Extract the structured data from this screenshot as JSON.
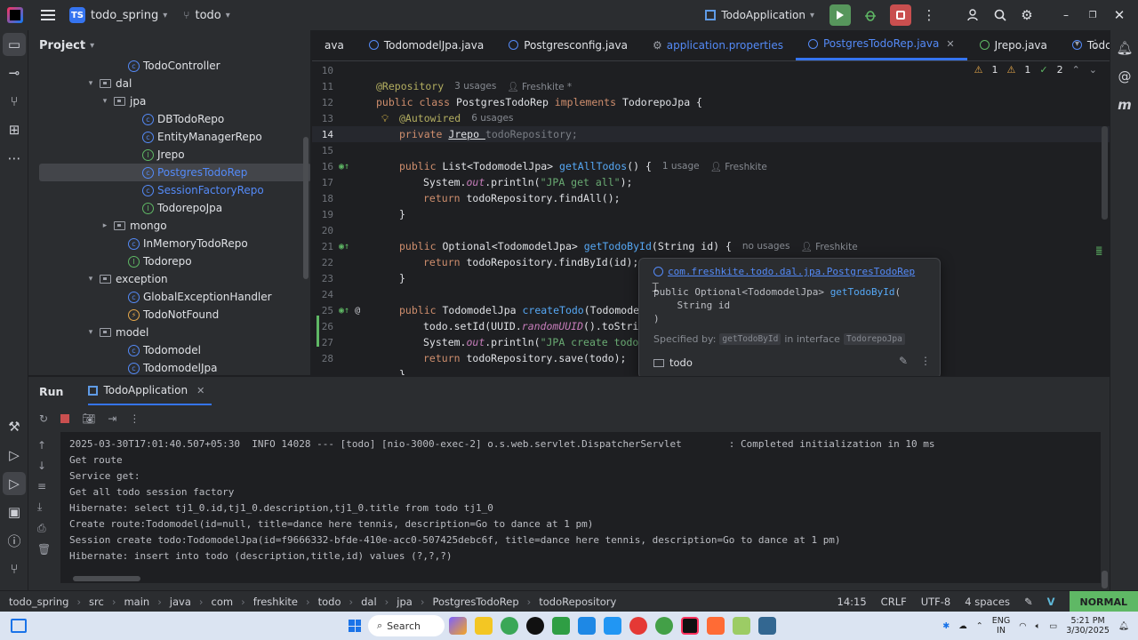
{
  "titlebar": {
    "project_badge": "TS",
    "project_name": "todo_spring",
    "branch": "todo",
    "run_config": "TodoApplication"
  },
  "project_panel": {
    "title": "Project",
    "tree": [
      {
        "label": "TodoController",
        "kind": "class",
        "indent": 7
      },
      {
        "label": "dal",
        "kind": "package",
        "indent": 5,
        "expanded": true
      },
      {
        "label": "jpa",
        "kind": "package",
        "indent": 6,
        "expanded": true
      },
      {
        "label": "DBTodoRepo",
        "kind": "class",
        "indent": 8
      },
      {
        "label": "EntityManagerRepo",
        "kind": "class",
        "indent": 8
      },
      {
        "label": "Jrepo",
        "kind": "interface",
        "indent": 8
      },
      {
        "label": "PostgresTodoRep",
        "kind": "class",
        "indent": 8,
        "selected": true
      },
      {
        "label": "SessionFactoryRepo",
        "kind": "class",
        "indent": 8,
        "blue": true
      },
      {
        "label": "TodorepoJpa",
        "kind": "interface",
        "indent": 8
      },
      {
        "label": "mongo",
        "kind": "package",
        "indent": 6,
        "expanded": false
      },
      {
        "label": "InMemoryTodoRepo",
        "kind": "class",
        "indent": 7
      },
      {
        "label": "Todorepo",
        "kind": "interface",
        "indent": 7
      },
      {
        "label": "exception",
        "kind": "package",
        "indent": 5,
        "expanded": true
      },
      {
        "label": "GlobalExceptionHandler",
        "kind": "class",
        "indent": 7
      },
      {
        "label": "TodoNotFound",
        "kind": "exception",
        "indent": 7
      },
      {
        "label": "model",
        "kind": "package",
        "indent": 5,
        "expanded": true
      },
      {
        "label": "Todomodel",
        "kind": "class",
        "indent": 7
      },
      {
        "label": "TodomodelJpa",
        "kind": "class",
        "indent": 7
      }
    ]
  },
  "editor": {
    "tabs": [
      {
        "label": "ava",
        "icon": "none"
      },
      {
        "label": "TodomodelJpa.java",
        "icon": "class"
      },
      {
        "label": "Postgresconfig.java",
        "icon": "class"
      },
      {
        "label": "application.properties",
        "icon": "gear",
        "blue": true
      },
      {
        "label": "PostgresTodoRep.java",
        "icon": "class",
        "active": true,
        "blue": true
      },
      {
        "label": "Jrepo.java",
        "icon": "interface"
      },
      {
        "label": "Todc",
        "icon": "class"
      }
    ],
    "inspections": {
      "warnings": "1",
      "weak": "1",
      "checks": "2"
    },
    "code": {
      "l10": "10",
      "l11": "11",
      "l11_ann": "@Repository",
      "l11_hint1": "3 usages",
      "l11_hint2": "Freshkite *",
      "l12": "12",
      "l12_kw": "public class ",
      "l12_name": "PostgresTodoRep ",
      "l12_kw2": "implements ",
      "l12_type": "TodorepoJpa {",
      "l13": "13",
      "l13_ann": "@Autowired",
      "l13_hint": "6 usages",
      "l14": "14",
      "l14_kw": "private ",
      "l14_type": "Jrepo ",
      "l14_field": "todoRepository;",
      "l15": "15",
      "l16": "16",
      "l16_kw": "public ",
      "l16_type": "List<TodomodelJpa> ",
      "l16_fn": "getAllTodos",
      "l16_rest": "() {",
      "l16_hint1": "1 usage",
      "l16_hint2": "Freshkite",
      "l17": "17",
      "l17_a": "System.",
      "l17_out": "out",
      "l17_b": ".println(",
      "l17_str": "\"JPA get all\"",
      "l17_c": ");",
      "l18": "18",
      "l18_kw": "return ",
      "l18_rest": "todoRepository.findAll();",
      "l19": "19",
      "l19_text": "}",
      "l20": "20",
      "l21": "21",
      "l21_kw": "public ",
      "l21_type": "Optional<TodomodelJpa> ",
      "l21_fn": "getTodoById",
      "l21_rest": "(String id) {",
      "l21_hint1": "no usages",
      "l21_hint2": "Freshkite",
      "l22": "22",
      "l22_kw": "return ",
      "l22_rest": "todoRepository.findById(id);",
      "l23": "23",
      "l23_text": "}",
      "l24": "24",
      "l25": "25",
      "l25_kw": "public ",
      "l25_type": "TodomodelJpa ",
      "l25_fn": "createTodo",
      "l25_rest": "(Todomodel",
      "l26": "26",
      "l26_a": "todo.setId(UUID.",
      "l26_it": "randomUUID",
      "l26_b": "().toStrin",
      "l27": "27",
      "l27_a": "System.",
      "l27_out": "out",
      "l27_b": ".println(",
      "l27_str": "\"JPA create todo:",
      "l28": "28",
      "l28_kw": "return ",
      "l28_rest": "todoRepository.save(todo);",
      "l29": "",
      "l29_text": "}"
    }
  },
  "popup": {
    "link": "com.freshkite.todo.dal.jpa.PostgresTodoRep",
    "sig_line1": "public Optional<TodomodelJpa> ",
    "sig_fn": "getTodoById",
    "sig_paren": "(",
    "sig_line2": "    String id",
    "sig_line3": ")",
    "spec_prefix": "Specified by:",
    "spec_method": "getTodoById",
    "spec_mid": "in interface",
    "spec_iface": "TodorepoJpa",
    "module": "todo"
  },
  "run_panel": {
    "title": "Run",
    "tab": "TodoApplication",
    "console": [
      "2025-03-30T17:01:40.507+05:30  INFO 14028 --- [todo] [nio-3000-exec-2] o.s.web.servlet.DispatcherServlet        : Completed initialization in 10 ms",
      "Get route",
      "Service get:",
      "Get all todo session factory",
      "Hibernate: select tj1_0.id,tj1_0.description,tj1_0.title from todo tj1_0",
      "Create route:Todomodel(id=null, title=dance here tennis, description=Go to dance at 1 pm)",
      "Session create todo:TodomodelJpa(id=f9666332-bfde-410e-acc0-507425debc6f, title=dance here tennis, description=Go to dance at 1 pm)",
      "Hibernate: insert into todo (description,title,id) values (?,?,?)"
    ]
  },
  "statusbar": {
    "breadcrumbs": [
      "todo_spring",
      "src",
      "main",
      "java",
      "com",
      "freshkite",
      "todo",
      "dal",
      "jpa",
      "PostgresTodoRep",
      "todoRepository"
    ],
    "position": "14:15",
    "line_sep": "CRLF",
    "encoding": "UTF-8",
    "indent": "4 spaces",
    "mode": "NORMAL"
  },
  "taskbar": {
    "search": "Search",
    "lang1": "ENG",
    "lang2": "IN",
    "time": "5:21 PM",
    "date": "3/30/2025"
  },
  "colors": {
    "accent": "#3574f0",
    "keyword": "#cf8e6d",
    "function": "#56a8f5",
    "string": "#6aab73",
    "annotation": "#b3ae60",
    "run_green": "#57965c",
    "stop_red": "#c94f4f"
  }
}
